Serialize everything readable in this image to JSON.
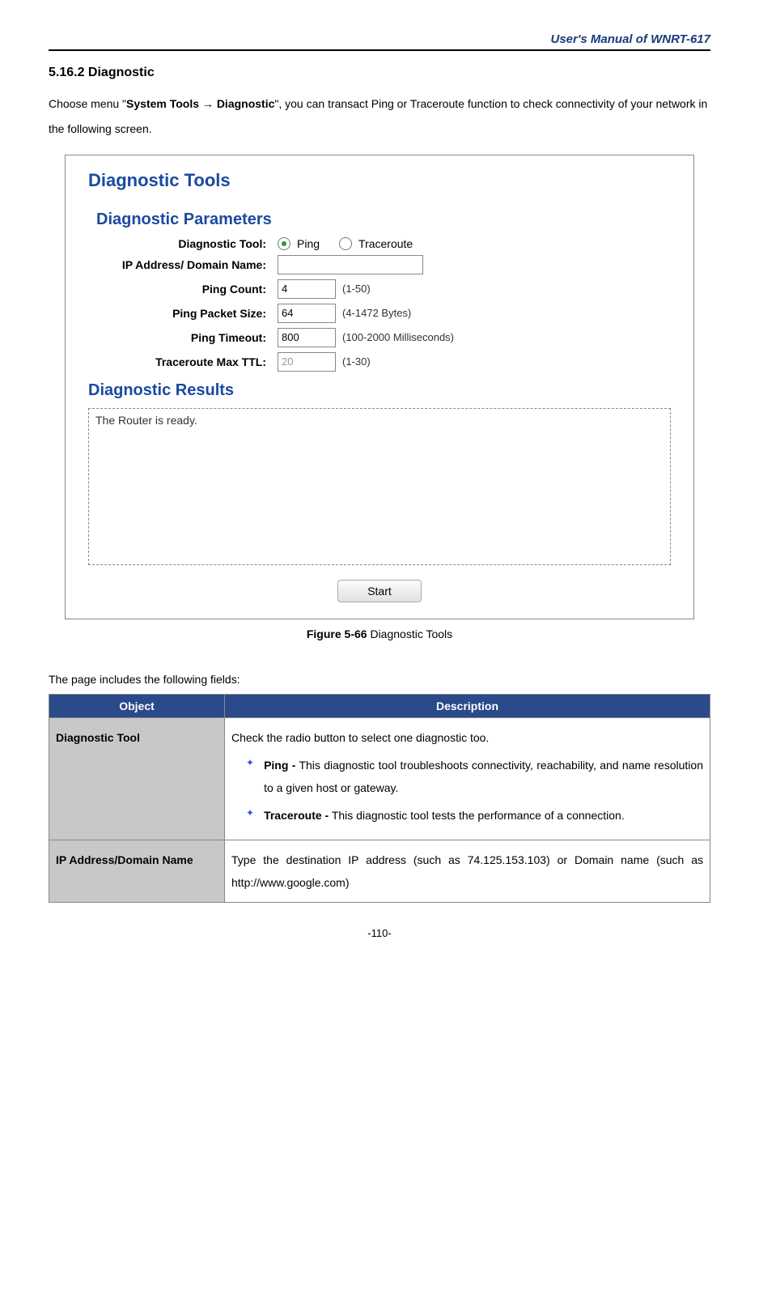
{
  "header": {
    "title": "User's Manual of WNRT-617"
  },
  "section": {
    "heading": "5.16.2  Diagnostic",
    "intro_pre": "Choose menu \"",
    "intro_bold1": "System Tools",
    "intro_arrow": " → ",
    "intro_bold2": "Diagnostic",
    "intro_post": "\", you can transact Ping or Traceroute function to check connectivity of your network in the following screen."
  },
  "screenshot": {
    "title": "Diagnostic Tools",
    "params_title": "Diagnostic Parameters",
    "labels": {
      "tool": "Diagnostic Tool:",
      "ip": "IP Address/ Domain Name:",
      "count": "Ping Count:",
      "packet": "Ping Packet Size:",
      "timeout": "Ping Timeout:",
      "ttl": "Traceroute Max TTL:"
    },
    "radios": {
      "ping": "Ping",
      "traceroute": "Traceroute"
    },
    "values": {
      "ip": "",
      "count": "4",
      "packet": "64",
      "timeout": "800",
      "ttl": "20"
    },
    "hints": {
      "count": "(1-50)",
      "packet": "(4-1472 Bytes)",
      "timeout": "(100-2000 Milliseconds)",
      "ttl": "(1-30)"
    },
    "results_title": "Diagnostic Results",
    "results_text": "The Router is ready.",
    "start_button": "Start"
  },
  "figure": {
    "label": "Figure 5-66",
    "caption": "  Diagnostic Tools"
  },
  "fields_intro": "The page includes the following fields:",
  "table": {
    "headers": {
      "object": "Object",
      "description": "Description"
    },
    "rows": [
      {
        "object": "Diagnostic Tool",
        "desc_intro": "Check the radio button to select one diagnostic too.",
        "bullets": [
          {
            "bold": "Ping -",
            "rest": " This diagnostic tool troubleshoots connectivity, reachability, and name resolution to a given host or gateway."
          },
          {
            "bold": "Traceroute -",
            "rest": " This diagnostic tool tests the performance of a connection."
          }
        ]
      },
      {
        "object": "IP Address/Domain Name",
        "desc": "Type the destination IP address (such as 74.125.153.103) or Domain name (such as http://www.google.com)"
      }
    ]
  },
  "page_number": "-110-"
}
